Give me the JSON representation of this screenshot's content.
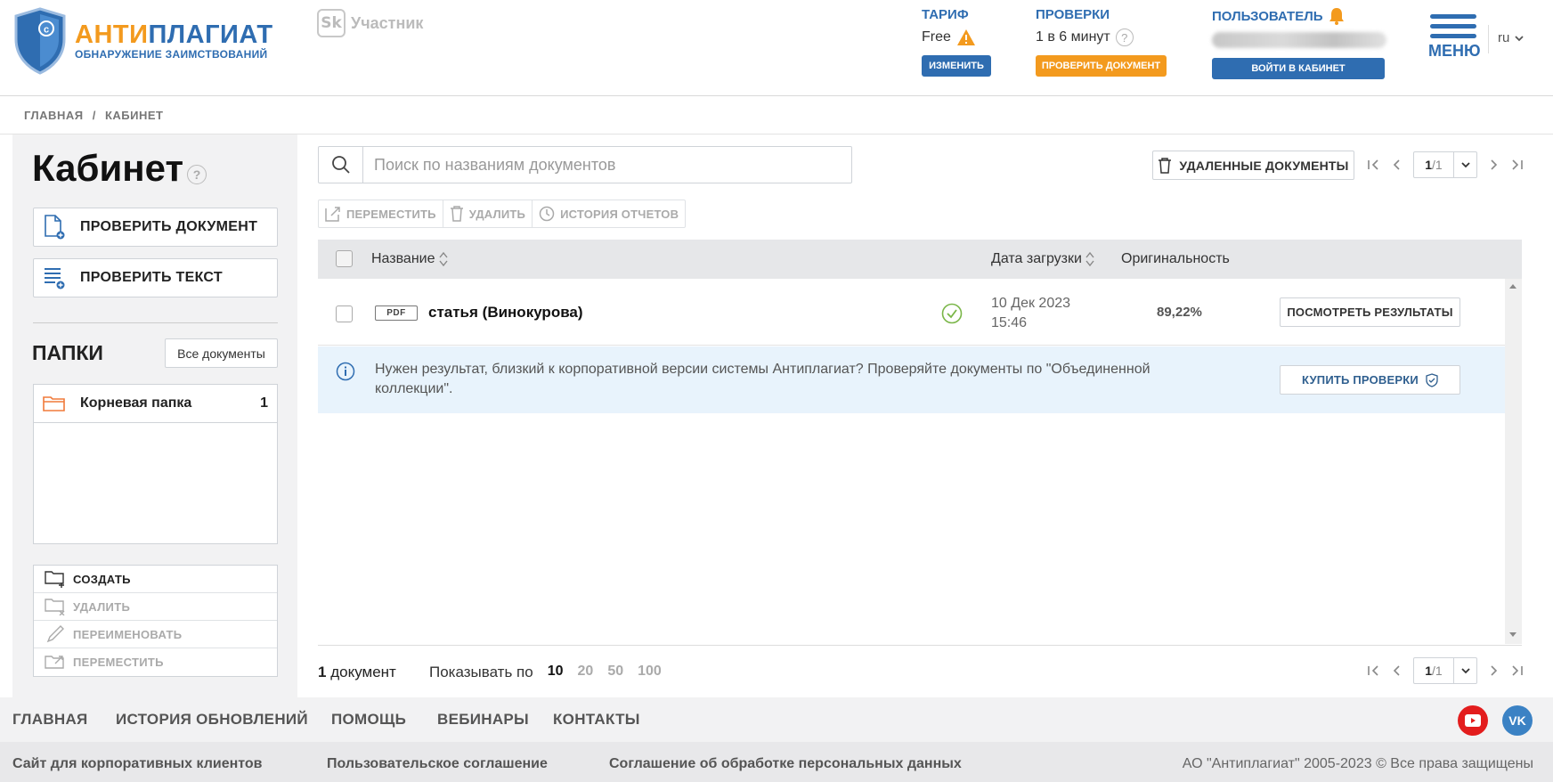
{
  "header": {
    "logo_part1": "АНТИ",
    "logo_part2": "ПЛАГИАТ",
    "logo_sub": "ОБНАРУЖЕНИЕ ЗАИМСТВОВАНИЙ",
    "sk_mark": "Sk",
    "sk_label": "Участник",
    "tariff": {
      "title": "ТАРИФ",
      "value": "Free",
      "button": "ИЗМЕНИТЬ"
    },
    "checks": {
      "title": "ПРОВЕРКИ",
      "value": "1 в 6 минут",
      "button": "ПРОВЕРИТЬ ДОКУМЕНТ"
    },
    "user": {
      "title": "ПОЛЬЗОВАТЕЛЬ",
      "button": "ВОЙТИ В КАБИНЕТ"
    },
    "menu_label": "МЕНЮ",
    "language": "ru"
  },
  "breadcrumb": {
    "home": "ГЛАВНАЯ",
    "separator": "/",
    "current": "КАБИНЕТ"
  },
  "sidebar": {
    "title": "Кабинет",
    "check_document": "ПРОВЕРИТЬ ДОКУМЕНТ",
    "check_text": "ПРОВЕРИТЬ ТЕКСТ",
    "folders_title": "ПАПКИ",
    "all_docs": "Все документы",
    "folders": [
      {
        "name": "Корневая папка",
        "count": "1"
      }
    ],
    "actions": {
      "create": "СОЗДАТЬ",
      "delete": "УДАЛИТЬ",
      "rename": "ПЕРЕИМЕНОВАТЬ",
      "move": "ПЕРЕМЕСТИТЬ"
    }
  },
  "main": {
    "search_placeholder": "Поиск по названиям документов",
    "deleted_docs": "УДАЛЕННЫЕ ДОКУМЕНТЫ",
    "pager": {
      "current": "1",
      "total": "/1"
    },
    "toolbar": {
      "move": "ПЕРЕМЕСТИТЬ",
      "delete": "УДАЛИТЬ",
      "history": "ИСТОРИЯ ОТЧЕТОВ"
    },
    "columns": {
      "name": "Название",
      "date": "Дата загрузки",
      "originality": "Оригинальность"
    },
    "rows": [
      {
        "type": "PDF",
        "name": "статья (Винокурова)",
        "date": "10 Дек 2023",
        "time": "15:46",
        "originality": "89,22%",
        "action": "ПОСМОТРЕТЬ РЕЗУЛЬТАТЫ"
      }
    ],
    "info": {
      "text": "Нужен результат, близкий к корпоративной версии системы Антиплагиат? Проверяйте документы по \"Объединенной коллекции\".",
      "button": "КУПИТЬ ПРОВЕРКИ"
    },
    "footer": {
      "count": "1",
      "count_label": "документ",
      "per_page_label": "Показывать по",
      "per_page_options": [
        "10",
        "20",
        "50",
        "100"
      ]
    }
  },
  "footer": {
    "nav": [
      "ГЛАВНАЯ",
      "ИСТОРИЯ ОБНОВЛЕНИЙ",
      "ПОМОЩЬ",
      "ВЕБИНАРЫ",
      "КОНТАКТЫ"
    ],
    "links": [
      "Сайт для корпоративных клиентов",
      "Пользовательское соглашение",
      "Соглашение об обработке персональных данных"
    ],
    "copyright": "АО \"Антиплагиат\" 2005-2023 © Все права защищены",
    "social": {
      "vk": "VK"
    }
  },
  "colors": {
    "brand_blue": "#2f6db1",
    "brand_orange": "#f39a1e",
    "youtube_red": "#e31d1d",
    "vk_blue": "#3b82c4"
  }
}
